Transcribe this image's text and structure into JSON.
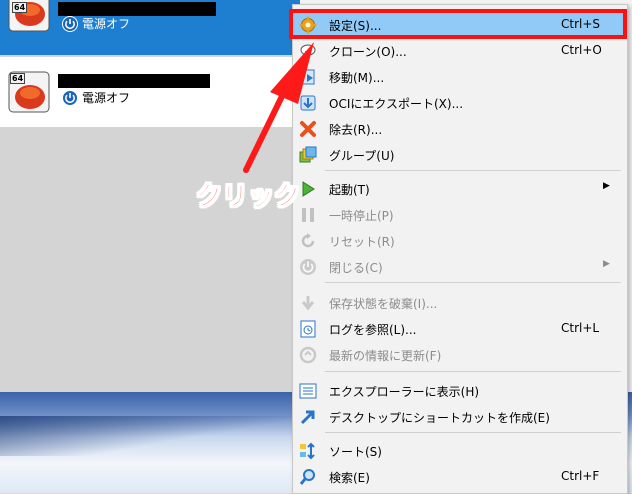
{
  "vm_list": {
    "items": [
      {
        "bits": "64",
        "state": "電源オフ"
      },
      {
        "bits": "64",
        "state": "電源オフ"
      }
    ]
  },
  "context_menu": {
    "items": [
      {
        "label": "設定(S)...",
        "shortcut": "Ctrl+S",
        "icon": "gear-icon"
      },
      {
        "label": "クローン(O)...",
        "shortcut": "Ctrl+O",
        "icon": "sheep-icon"
      },
      {
        "label": "移動(M)...",
        "shortcut": "",
        "icon": "move-icon"
      },
      {
        "label": "OCIにエクスポート(X)...",
        "shortcut": "",
        "icon": "export-icon"
      },
      {
        "label": "除去(R)...",
        "shortcut": "",
        "icon": "remove-icon"
      },
      {
        "label": "グループ(U)",
        "shortcut": "",
        "icon": "group-icon"
      },
      {
        "label": "起動(T)",
        "shortcut": "",
        "icon": "start-icon"
      },
      {
        "label": "一時停止(P)",
        "shortcut": "",
        "icon": "pause-icon"
      },
      {
        "label": "リセット(R)",
        "shortcut": "",
        "icon": "reset-icon"
      },
      {
        "label": "閉じる(C)",
        "shortcut": "",
        "icon": "power-icon"
      },
      {
        "label": "保存状態を破棄(I)...",
        "shortcut": "",
        "icon": "discard-icon"
      },
      {
        "label": "ログを参照(L)...",
        "shortcut": "Ctrl+L",
        "icon": "log-icon"
      },
      {
        "label": "最新の情報に更新(F)",
        "shortcut": "",
        "icon": "refresh-icon"
      },
      {
        "label": "エクスプローラーに表示(H)",
        "shortcut": "",
        "icon": "explorer-icon"
      },
      {
        "label": "デスクトップにショートカットを作成(E)",
        "shortcut": "",
        "icon": "shortcut-icon"
      },
      {
        "label": "ソート(S)",
        "shortcut": "",
        "icon": "sort-icon"
      },
      {
        "label": "検索(E)",
        "shortcut": "Ctrl+F",
        "icon": "search-icon"
      }
    ]
  },
  "annotation": {
    "click_label": "クリック",
    "highlight_color": "#ff1010"
  }
}
